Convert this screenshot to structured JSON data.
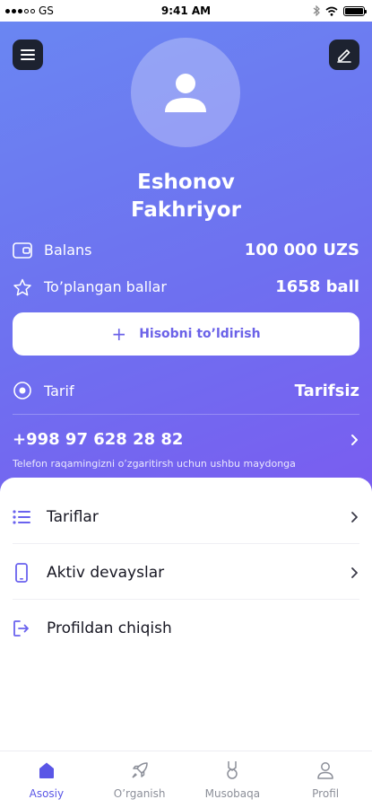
{
  "status_bar": {
    "carrier": "GS",
    "time": "9:41 AM",
    "battery_level": 1.0
  },
  "header": {
    "menu_icon": "hamburger-menu-icon",
    "edit_icon": "pencil-edit-icon",
    "avatar_icon": "user-avatar-icon",
    "name_line1": "Eshonov",
    "name_line2": "Fakhriyor"
  },
  "account": {
    "balance_label": "Balans",
    "balance_value": "100 000 UZS",
    "points_label": "To’plangan ballar",
    "points_value": "1658 ball",
    "topup_label": "Hisobni to’ldirish",
    "tariff_label": "Tarif",
    "tariff_value": "Tarifsiz",
    "phone": "+998 97 628 28 82",
    "phone_hint": "Telefon raqamingizni o’zgaritirsh uchun ushbu maydonga"
  },
  "menu": {
    "tariffs": "Tariflar",
    "devices": "Aktiv devayslar",
    "logout": "Profildan chiqish"
  },
  "tabs": [
    {
      "label": "Asosiy",
      "icon": "home-icon"
    },
    {
      "label": "O’rganish",
      "icon": "rocket-icon"
    },
    {
      "label": "Musobaqa",
      "icon": "medal-icon"
    },
    {
      "label": "Profil",
      "icon": "profile-icon"
    }
  ],
  "colors": {
    "gradient_start": "#6a86f2",
    "gradient_end": "#7a5cf0",
    "accent": "#5a56e6",
    "icon_button_bg": "#1d2230"
  }
}
